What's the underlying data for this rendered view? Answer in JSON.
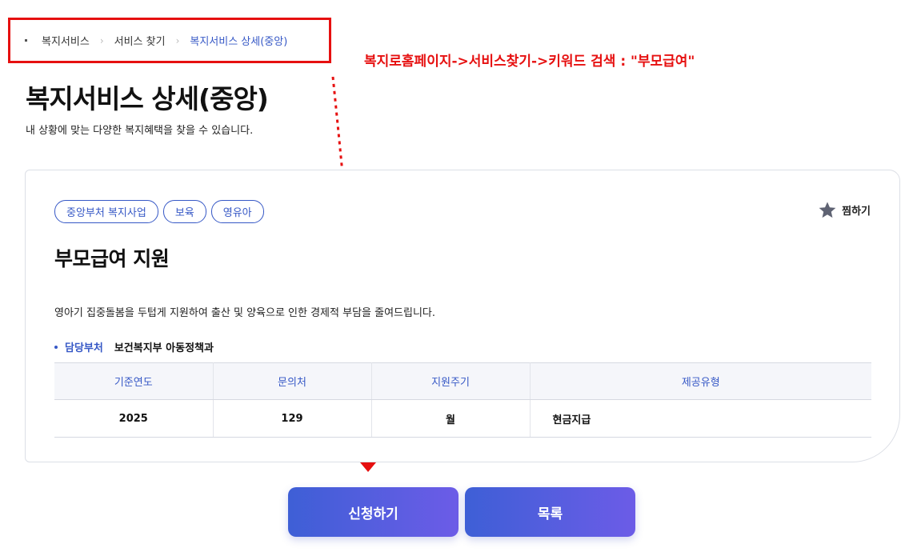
{
  "breadcrumb": {
    "items": [
      "복지서비스",
      "서비스 찾기",
      "복지서비스 상세(중앙)"
    ],
    "separator": "›"
  },
  "annotation": {
    "text": "복지로홈페이지->서비스찾기->키워드 검색 : \"부모급여\""
  },
  "page": {
    "title": "복지서비스 상세(중앙)",
    "description": "내 상황에 맞는 다양한 복지혜택을 찾을 수 있습니다."
  },
  "card": {
    "tags": [
      "중앙부처 복지사업",
      "보육",
      "영유아"
    ],
    "favorite_label": "찜하기",
    "service_title": "부모급여 지원",
    "service_desc": "영아기 집중돌봄을 두텁게 지원하여 출산 및 양육으로 인한 경제적 부담을 줄여드립니다.",
    "dept_label": "담당부처",
    "dept_value": "보건복지부 아동정책과",
    "table": {
      "headers": [
        "기준연도",
        "문의처",
        "지원주기",
        "제공유형"
      ],
      "row": [
        "2025",
        "129",
        "월",
        "현금지급"
      ]
    }
  },
  "buttons": {
    "apply": "신청하기",
    "list": "목록"
  },
  "colors": {
    "accent": "#3658c6",
    "annotation": "#e61010",
    "button_gradient_start": "#3e5fd6",
    "button_gradient_end": "#6c5ce7"
  }
}
